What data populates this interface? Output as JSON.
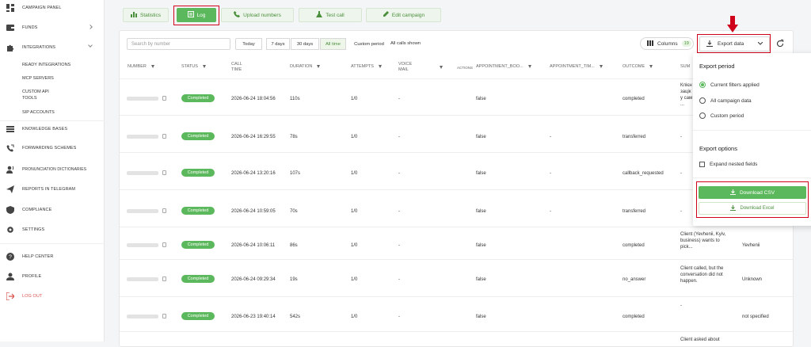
{
  "sidebar": {
    "items": [
      {
        "label": "Campaign Panel",
        "icon": "dashboard-icon"
      },
      {
        "label": "Funds",
        "icon": "wallet-icon"
      },
      {
        "label": "Integrations",
        "icon": "puzzle-icon"
      },
      {
        "label": "Knowledge Bases",
        "icon": "list-icon"
      },
      {
        "label": "Forwarding Schemes",
        "icon": "phone-forward-icon"
      },
      {
        "label": "Pronunciation Dictionaries",
        "icon": "speaker-icon"
      },
      {
        "label": "Reports in Telegram",
        "icon": "send-icon"
      },
      {
        "label": "Compliance",
        "icon": "shield-icon"
      },
      {
        "label": "Settings",
        "icon": "gear-icon"
      },
      {
        "label": "Help Center",
        "icon": "help-icon"
      },
      {
        "label": "Profile",
        "icon": "user-icon"
      },
      {
        "label": "Log out",
        "icon": "logout-icon"
      }
    ],
    "sub_items": [
      "Ready Integrations",
      "MCP Servers",
      "Custom API",
      "Tools",
      "SIP Accounts"
    ]
  },
  "tabs": [
    {
      "label": "Statistics",
      "icon": "chart-icon"
    },
    {
      "label": "Log",
      "icon": "log-icon"
    },
    {
      "label": "Upload numbers",
      "icon": "phone-icon"
    },
    {
      "label": "Test call",
      "icon": "flask-icon"
    },
    {
      "label": "Edit campaign",
      "icon": "pencil-icon"
    }
  ],
  "toolbar": {
    "search_placeholder": "Search by number",
    "filters": [
      "Today",
      "7 days",
      "30 days",
      "All time",
      "Custom period"
    ],
    "selected_filter": "All time",
    "calls_shown": "All calls shown",
    "columns_label": "Columns",
    "columns_count": "19",
    "export_label": "Export data"
  },
  "table": {
    "headers": [
      "Number",
      "Status",
      "Call",
      "Time",
      "Duration",
      "Attempts",
      "Voice",
      "Mail",
      "Actions",
      "Appointment_boo...",
      "Appointment_tim...",
      "Outcome",
      "Sum"
    ],
    "rows": [
      {
        "status": "Completed",
        "time": "2026-06-24 18:04:56",
        "duration": "110s",
        "attempts": "1/0",
        "voicemail": "-",
        "booked": "false",
        "apt_time": "",
        "outcome": "completed",
        "summary": "",
        "name": ""
      },
      {
        "status": "Completed",
        "time": "2026-06-24 16:29:55",
        "duration": "78s",
        "attempts": "1/0",
        "voicemail": "-",
        "booked": "false",
        "apt_time": "-",
        "outcome": "transferred",
        "summary": "-",
        "name": ""
      },
      {
        "status": "Completed",
        "time": "2026-06-24 13:20:16",
        "duration": "107s",
        "attempts": "1/0",
        "voicemail": "-",
        "booked": "false",
        "apt_time": "-",
        "outcome": "callback_requested",
        "summary": "-",
        "name": ""
      },
      {
        "status": "Completed",
        "time": "2026-06-24 10:59:05",
        "duration": "70s",
        "attempts": "1/0",
        "voicemail": "-",
        "booked": "false",
        "apt_time": "-",
        "outcome": "transferred",
        "summary": "-",
        "name": ""
      },
      {
        "status": "Completed",
        "time": "2026-06-24 10:06:11",
        "duration": "86s",
        "attempts": "1/0",
        "voicemail": "-",
        "booked": "false",
        "apt_time": "",
        "outcome": "completed",
        "summary": "Client (Yevhenii, Kyiv, business) wants to pick...",
        "name": "Yevhenii"
      },
      {
        "status": "Completed",
        "time": "2026-06-24 09:29:34",
        "duration": "19s",
        "attempts": "1/0",
        "voicemail": "-",
        "booked": "false",
        "apt_time": "",
        "outcome": "no_answer",
        "summary": "Client called, but the conversation did not happen.",
        "name": "Unknown"
      },
      {
        "status": "Completed",
        "time": "2026-06-23 19:40:14",
        "duration": "542s",
        "attempts": "1/0",
        "voicemail": "-",
        "booked": "false",
        "apt_time": "",
        "outcome": "completed",
        "summary": "-",
        "name": "not specified"
      }
    ],
    "partial_summaries": [
      "Клієн",
      "зацік",
      "у сам",
      "...",
      "Client asked about"
    ]
  },
  "export_panel": {
    "period_title": "Export period",
    "options": [
      "Current filters applied",
      "All campaign data",
      "Custom period"
    ],
    "selected_option": "Current filters applied",
    "options_title": "Export options",
    "expand_label": "Expand nested fields",
    "csv_label": "Download CSV",
    "excel_label": "Download Excel"
  },
  "colors": {
    "accent": "#5cb85c",
    "highlight": "#d0021b",
    "logout": "#d9534f"
  }
}
